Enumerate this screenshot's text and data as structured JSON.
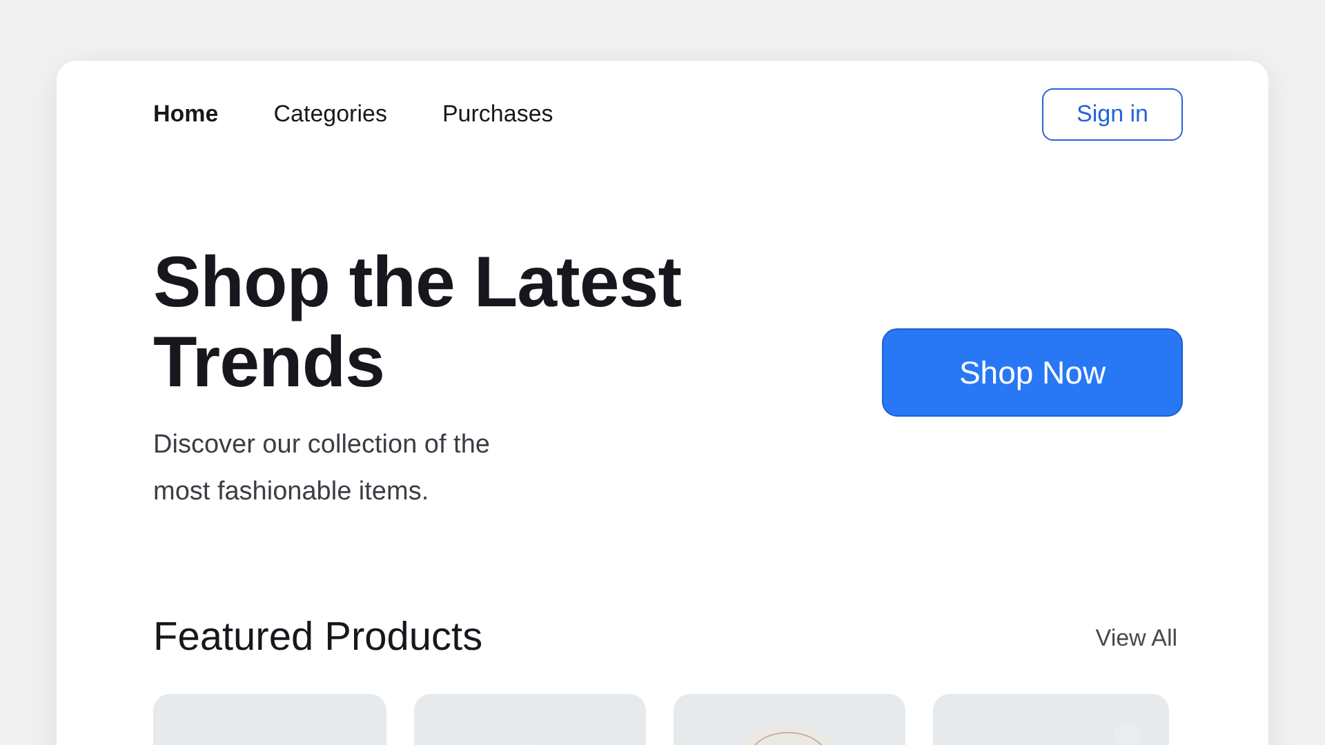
{
  "nav": {
    "items": [
      {
        "label": "Home",
        "selected": true
      },
      {
        "label": "Categories",
        "selected": false
      },
      {
        "label": "Purchases",
        "selected": false
      }
    ],
    "sign_in": "Sign in"
  },
  "hero": {
    "title": "Shop the Latest Trends",
    "subtitle": "Discover our collection of the most fashionable items.",
    "button": "Shop Now"
  },
  "featured": {
    "title": "Featured Products",
    "view_all": "View All"
  }
}
